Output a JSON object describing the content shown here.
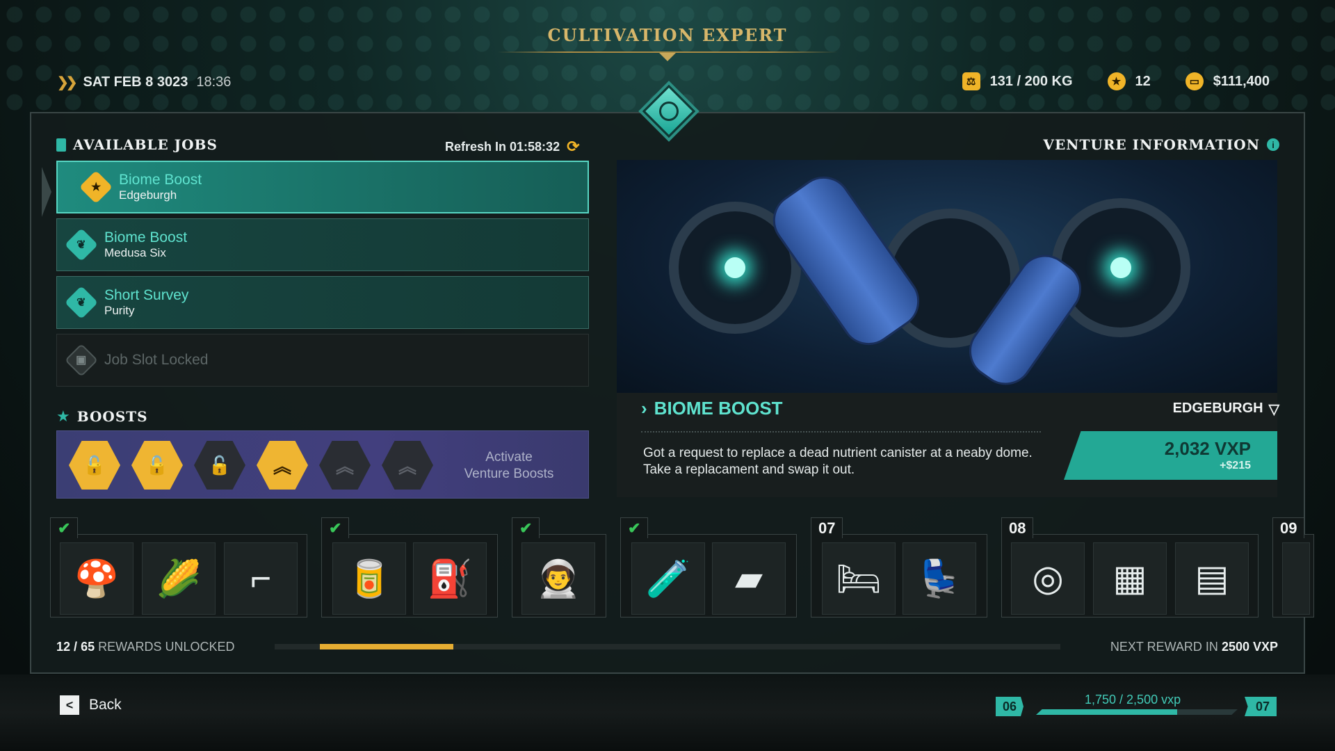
{
  "header": {
    "title": "CULTIVATION EXPERT",
    "date": "SAT FEB 8 3023",
    "time": "18:36",
    "weight": "131 / 200 KG",
    "stars": "12",
    "money": "$111,400"
  },
  "jobs": {
    "heading": "AVAILABLE JOBS",
    "refresh_label": "Refresh In 01:58:32",
    "items": [
      {
        "title": "Biome Boost",
        "location": "Edgeburgh",
        "icon": "star-icon",
        "selected": true
      },
      {
        "title": "Biome Boost",
        "location": "Medusa Six",
        "icon": "leaf-icon"
      },
      {
        "title": "Short Survey",
        "location": "Purity",
        "icon": "leaf-icon"
      },
      {
        "title": "Job Slot Locked",
        "location": "",
        "icon": "lock-icon",
        "locked": true
      }
    ]
  },
  "boosts": {
    "heading": "BOOSTS",
    "activate_line1": "Activate",
    "activate_line2": "Venture Boosts",
    "slots": [
      {
        "state": "unlocked",
        "icon": "padlock-open-icon"
      },
      {
        "state": "unlocked",
        "icon": "padlock-open-icon"
      },
      {
        "state": "inactive",
        "icon": "padlock-open-icon"
      },
      {
        "state": "active",
        "icon": "chevron-rank-icon"
      },
      {
        "state": "inactive",
        "icon": "chevron-rank-icon"
      },
      {
        "state": "inactive",
        "icon": "chevron-rank-icon"
      }
    ]
  },
  "venture": {
    "heading": "VENTURE INFORMATION",
    "title": "BIOME BOOST",
    "location": "EDGEBURGH",
    "description": "Got a request to replace a dead nutrient canister at a neaby dome. Take a replacament and swap it out.",
    "reward_vxp": "2,032 VXP",
    "reward_money": "+$215"
  },
  "rewards": {
    "tiers": [
      {
        "label": "✔",
        "claimed": true,
        "items": [
          "mushroom-shifter",
          "corn-customs-decal",
          "pipe-panel"
        ]
      },
      {
        "label": "✔",
        "claimed": true,
        "items": [
          "energy-can",
          "fuel-canister"
        ]
      },
      {
        "label": "✔",
        "claimed": true,
        "items": [
          "spacesuit"
        ]
      },
      {
        "label": "✔",
        "claimed": true,
        "items": [
          "nutrient-canister",
          "silver-bar"
        ]
      },
      {
        "label": "07",
        "claimed": false,
        "items": [
          "green-bed",
          "pilot-seat"
        ]
      },
      {
        "label": "08",
        "claimed": false,
        "items": [
          "duct-tape",
          "circuit-board",
          "storage-crate"
        ]
      },
      {
        "label": "09",
        "claimed": false,
        "items": []
      }
    ],
    "unlocked_count": "12",
    "unlocked_total": "65",
    "unlocked_label": "REWARDS UNLOCKED",
    "progress_fraction": 0.17,
    "next_reward_label": "NEXT REWARD IN",
    "next_reward_value": "2500 VXP"
  },
  "footer": {
    "back_key": "<",
    "back_label": "Back",
    "level_current": "06",
    "level_next": "07",
    "xp_text": "1,750 / 2,500 vxp",
    "xp_fraction": 0.7
  },
  "colors": {
    "accent": "#2fb8a6",
    "gold": "#f0b428",
    "title_gold": "#d7b66a",
    "boost_bar": "#423f7e"
  }
}
